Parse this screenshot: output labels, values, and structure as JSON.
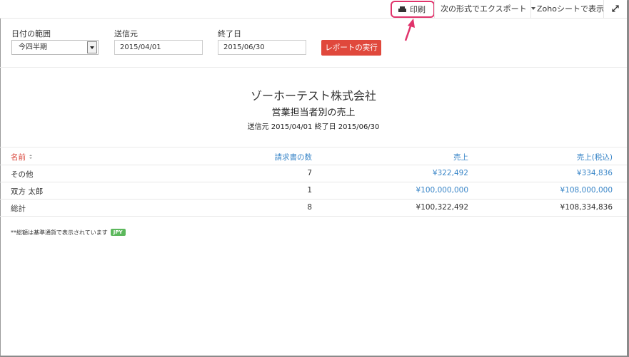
{
  "toolbar": {
    "print_label": "印刷",
    "export_label": "次の形式でエクスポート",
    "zoho_sheet_label": "Zohoシートで表示",
    "expand_icon": "expand-icon"
  },
  "filters": {
    "date_range_label": "日付の範囲",
    "date_range_value": "今四半期",
    "from_label": "送信元",
    "from_value": "2015/04/01",
    "to_label": "終了日",
    "to_value": "2015/06/30",
    "run_button": "レポートの実行"
  },
  "report": {
    "company": "ゾーホーテスト株式会社",
    "title": "営業担当者別の売上",
    "dates": "送信元 2015/04/01 終了日 2015/06/30"
  },
  "table": {
    "headers": [
      "名前",
      "請求書の数",
      "売上",
      "売上(税込)"
    ],
    "rows": [
      {
        "name": "その他",
        "count": "7",
        "sales": "¥322,492",
        "sales_tax": "¥334,836"
      },
      {
        "name": "双方 太郎",
        "count": "1",
        "sales": "¥100,000,000",
        "sales_tax": "¥108,000,000"
      }
    ],
    "total": {
      "name": "総計",
      "count": "8",
      "sales": "¥100,322,492",
      "sales_tax": "¥108,334,836"
    }
  },
  "footnote": {
    "text": "**総額は基準通貨で表示されています",
    "currency_badge": "JPY"
  },
  "colors": {
    "accent_red": "#e0483c",
    "link_blue": "#3a86c8",
    "highlight_pink": "#e0336b",
    "badge_green": "#5cb85c"
  }
}
